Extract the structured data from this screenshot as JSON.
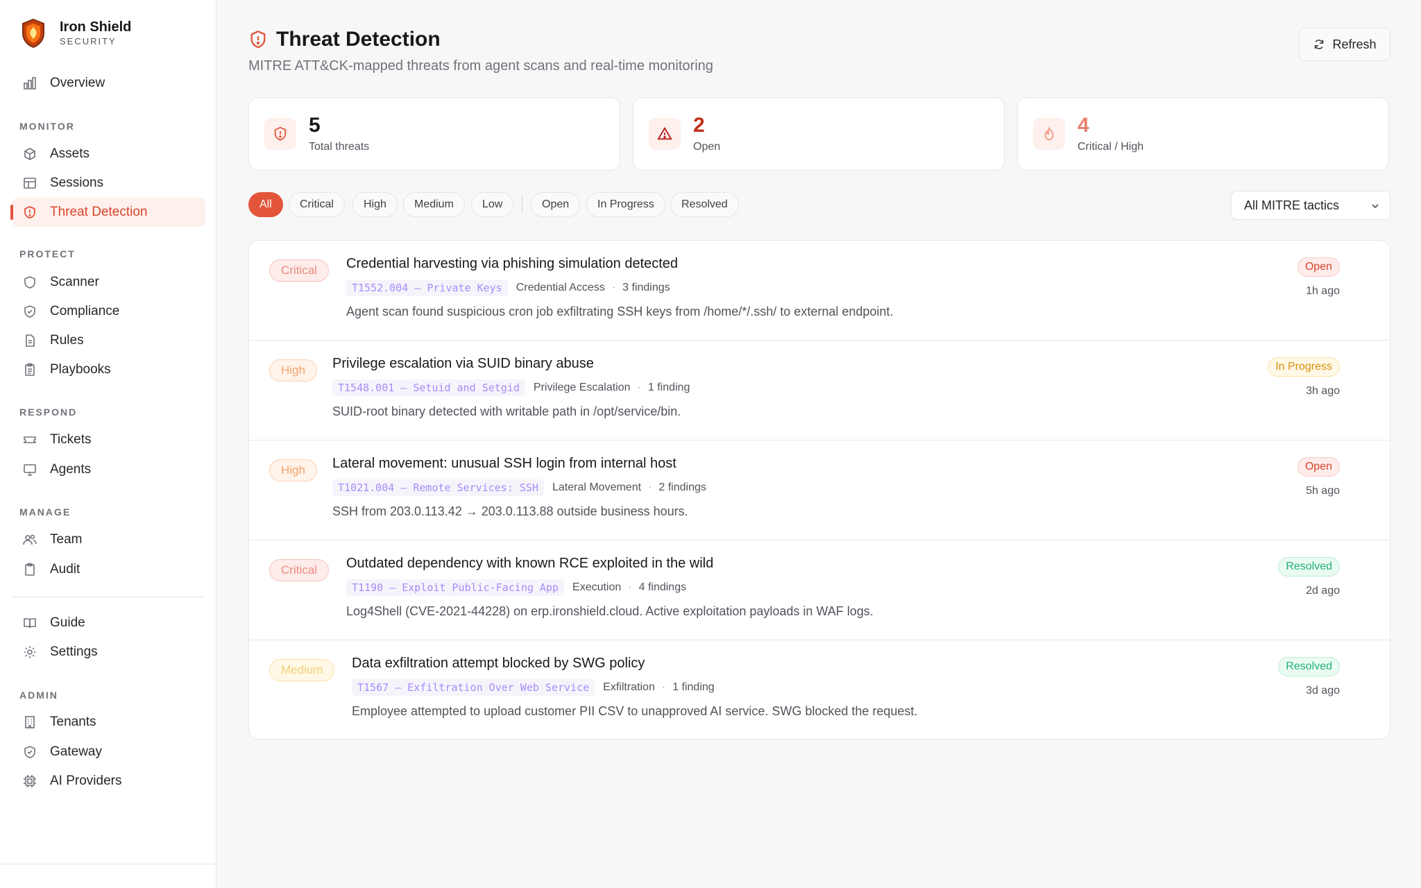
{
  "brand": {
    "name": "Iron Shield",
    "sub": "SECURITY"
  },
  "sidebar": {
    "overview": "Overview",
    "sections": {
      "monitor": "MONITOR",
      "protect": "PROTECT",
      "respond": "RESPOND",
      "manage": "MANAGE",
      "admin": "ADMIN"
    },
    "items": {
      "assets": "Assets",
      "sessions": "Sessions",
      "threat_detection": "Threat Detection",
      "scanner": "Scanner",
      "compliance": "Compliance",
      "rules": "Rules",
      "playbooks": "Playbooks",
      "tickets": "Tickets",
      "agents": "Agents",
      "team": "Team",
      "audit": "Audit",
      "guide": "Guide",
      "settings": "Settings",
      "tenants": "Tenants",
      "gateway": "Gateway",
      "ai_providers": "AI Providers"
    },
    "active": "threat_detection"
  },
  "header": {
    "title": "Threat Detection",
    "subtitle": "MITRE ATT&CK-mapped threats from agent scans and real-time monitoring",
    "refresh_label": "Refresh"
  },
  "stats": [
    {
      "value": "5",
      "label": "Total threats",
      "color": "#18181b"
    },
    {
      "value": "2",
      "label": "Open",
      "color": "#c0311f"
    },
    {
      "value": "4",
      "label": "Critical / High",
      "color": "#e8836f"
    }
  ],
  "filters": {
    "severity": [
      "All",
      "Critical",
      "High",
      "Medium",
      "Low"
    ],
    "status": [
      "Open",
      "In Progress",
      "Resolved"
    ],
    "active": "All",
    "tactic_select": "All MITRE tactics"
  },
  "threats": [
    {
      "severity": "Critical",
      "title": "Credential harvesting via phishing simulation detected",
      "technique": "T1552.004 – Private Keys",
      "tactic": "Credential Access",
      "findings": "3 findings",
      "description": "Agent scan found suspicious cron job exfiltrating SSH keys from /home/*/.ssh/ to external endpoint.",
      "status": "Open",
      "time": "1h ago"
    },
    {
      "severity": "High",
      "title": "Privilege escalation via SUID binary abuse",
      "technique": "T1548.001 – Setuid and Setgid",
      "tactic": "Privilege Escalation",
      "findings": "1 finding",
      "description": "SUID-root binary detected with writable path in /opt/service/bin.",
      "status": "In Progress",
      "time": "3h ago"
    },
    {
      "severity": "High",
      "title": "Lateral movement: unusual SSH login from internal host",
      "technique": "T1021.004 – Remote Services: SSH",
      "tactic": "Lateral Movement",
      "findings": "2 findings",
      "description": "SSH from 203.0.113.42 → 203.0.113.88 outside business hours.",
      "status": "Open",
      "time": "5h ago"
    },
    {
      "severity": "Critical",
      "title": "Outdated dependency with known RCE exploited in the wild",
      "technique": "T1190 – Exploit Public-Facing App",
      "tactic": "Execution",
      "findings": "4 findings",
      "description": "Log4Shell (CVE-2021-44228) on erp.ironshield.cloud. Active exploitation payloads in WAF logs.",
      "status": "Resolved",
      "time": "2d ago"
    },
    {
      "severity": "Medium",
      "title": "Data exfiltration attempt blocked by SWG policy",
      "technique": "T1567 – Exfiltration Over Web Service",
      "tactic": "Exfiltration",
      "findings": "1 finding",
      "description": "Employee attempted to upload customer PII CSV to unapproved AI service. SWG blocked the request.",
      "status": "Resolved",
      "time": "3d ago"
    }
  ],
  "colors": {
    "accent": "#e2553b",
    "critical": "#e98d80",
    "high": "#f2a36b",
    "medium": "#f3cf72",
    "resolved": "#22b07d"
  }
}
